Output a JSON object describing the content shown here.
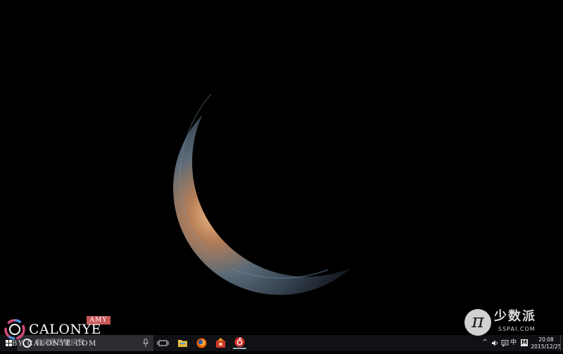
{
  "watermark_left": {
    "badge": "AMY",
    "brand": "CALONYE",
    "url": "BY CALONYE.COM"
  },
  "watermark_right": {
    "pi_glyph": "π",
    "name_cn": "少数派",
    "url": "SSPAI.COM"
  },
  "taskbar": {
    "search_placeholder": "有问题尽管问我",
    "apps": [
      {
        "name": "File Explorer",
        "icon": "folder-icon"
      },
      {
        "name": "Firefox",
        "icon": "firefox-icon"
      },
      {
        "name": "Game",
        "icon": "game-icon"
      },
      {
        "name": "NetEase Cloud Music",
        "icon": "music-icon"
      }
    ],
    "tray": {
      "chevron": "^",
      "ime_label": "中",
      "m_label": "M",
      "clock_time": "20:08",
      "clock_date": "2015/12/25"
    }
  },
  "colors": {
    "desktop_bg": "#000000",
    "taskbar_bg": "#101114",
    "search_bg": "#2c2d30",
    "watermark_badge": "#c9585a"
  }
}
